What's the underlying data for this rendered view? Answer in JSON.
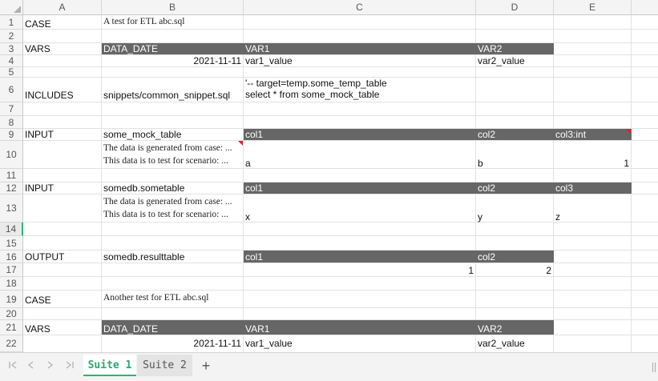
{
  "columns": [
    "A",
    "B",
    "C",
    "D",
    "E"
  ],
  "rows": [
    "1",
    "2",
    "3",
    "4",
    "5",
    "6",
    "7",
    "8",
    "9",
    "10",
    "11",
    "12",
    "13",
    "14",
    "15",
    "16",
    "17",
    "18",
    "19",
    "20",
    "21",
    "22"
  ],
  "cells": {
    "r1": {
      "a": "CASE",
      "b": "A test for ETL abc.sql"
    },
    "r3": {
      "a": "VARS",
      "b": "DATA_DATE",
      "c": "VAR1",
      "d": "VAR2"
    },
    "r4": {
      "b": "2021-11-11",
      "c": "var1_value",
      "d": "var2_value"
    },
    "r6": {
      "a": "INCLUDES",
      "b": "snippets/common_snippet.sql",
      "c1": "'-- target=temp.some_temp_table",
      "c2": "select * from some_mock_table"
    },
    "r9": {
      "a": "INPUT",
      "b": "some_mock_table",
      "c": "col1",
      "d": "col2",
      "e": "col3:int"
    },
    "r10": {
      "b1": "The data is generated from case: ...",
      "b2": "This data is to test for scenario: ...",
      "c": "a",
      "d": "b",
      "e": "1"
    },
    "r12": {
      "a": "INPUT",
      "b": "somedb.sometable",
      "c": "col1",
      "d": "col2",
      "e": "col3"
    },
    "r13": {
      "b1": "The data is generated from case: ...",
      "b2": "This data is to test for scenario: ...",
      "c": "x",
      "d": "y",
      "e": "z"
    },
    "r16": {
      "a": "OUTPUT",
      "b": "somedb.resulttable",
      "c": "col1",
      "d": "col2"
    },
    "r17": {
      "c": "1",
      "d": "2"
    },
    "r19": {
      "a": "CASE",
      "b": "Another test for ETL abc.sql"
    },
    "r21": {
      "a": "VARS",
      "b": "DATA_DATE",
      "c": "VAR1",
      "d": "VAR2"
    },
    "r22": {
      "b": "2021-11-11",
      "c": "var1_value",
      "d": "var2_value"
    }
  },
  "tabs": {
    "first_icon": "first-sheet-icon",
    "prev_icon": "prev-sheet-icon",
    "next_icon": "next-sheet-icon",
    "last_icon": "last-sheet-icon",
    "sheets": [
      "Suite 1",
      "Suite 2"
    ],
    "active": "Suite 1",
    "add_icon": "+"
  },
  "colors": {
    "header_fill": "#666666",
    "accent": "#2bb673",
    "note": "#d9262c"
  }
}
